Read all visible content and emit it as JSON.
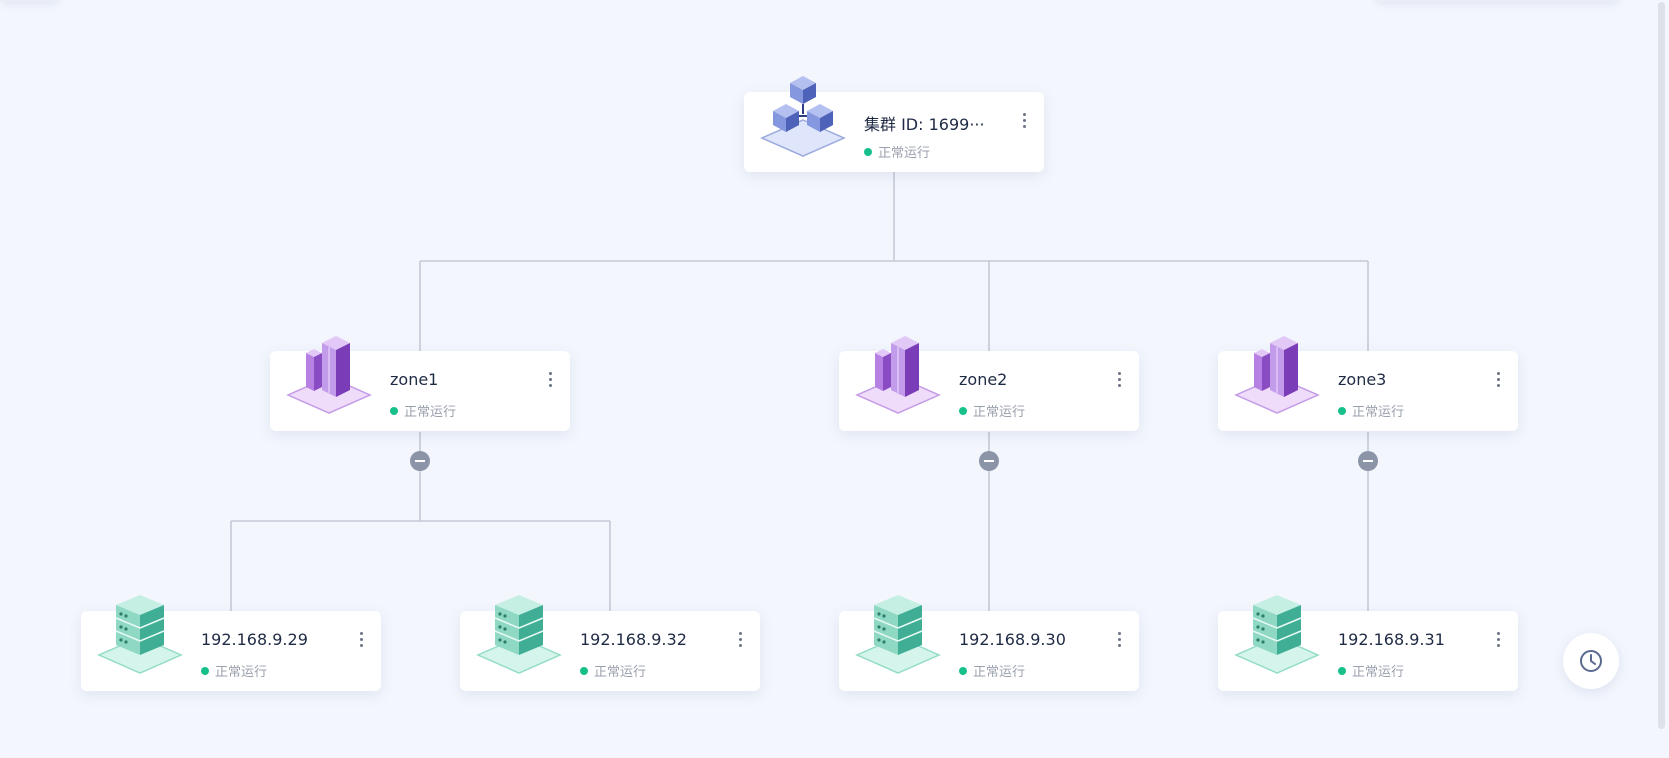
{
  "cluster": {
    "title": "集群 ID: 1699···",
    "status": "正常运行"
  },
  "zones": [
    {
      "title": "zone1",
      "status": "正常运行"
    },
    {
      "title": "zone2",
      "status": "正常运行"
    },
    {
      "title": "zone3",
      "status": "正常运行"
    }
  ],
  "servers": [
    {
      "title": "192.168.9.29",
      "status": "正常运行"
    },
    {
      "title": "192.168.9.32",
      "status": "正常运行"
    },
    {
      "title": "192.168.9.30",
      "status": "正常运行"
    },
    {
      "title": "192.168.9.31",
      "status": "正常运行"
    }
  ],
  "icons": {
    "cluster": "cluster-cubes-icon",
    "zone": "zone-building-icon",
    "server": "server-stack-icon",
    "more": "more-vertical-icon",
    "collapse": "collapse-minus-icon",
    "history": "clock-icon"
  },
  "colors": {
    "background": "#f3f6fd",
    "status_ok": "#17c08a",
    "line": "#c4cad6",
    "cluster_icon": "#5a6fc0",
    "zone_icon": "#8a4cc2",
    "server_icon": "#3fae95"
  }
}
